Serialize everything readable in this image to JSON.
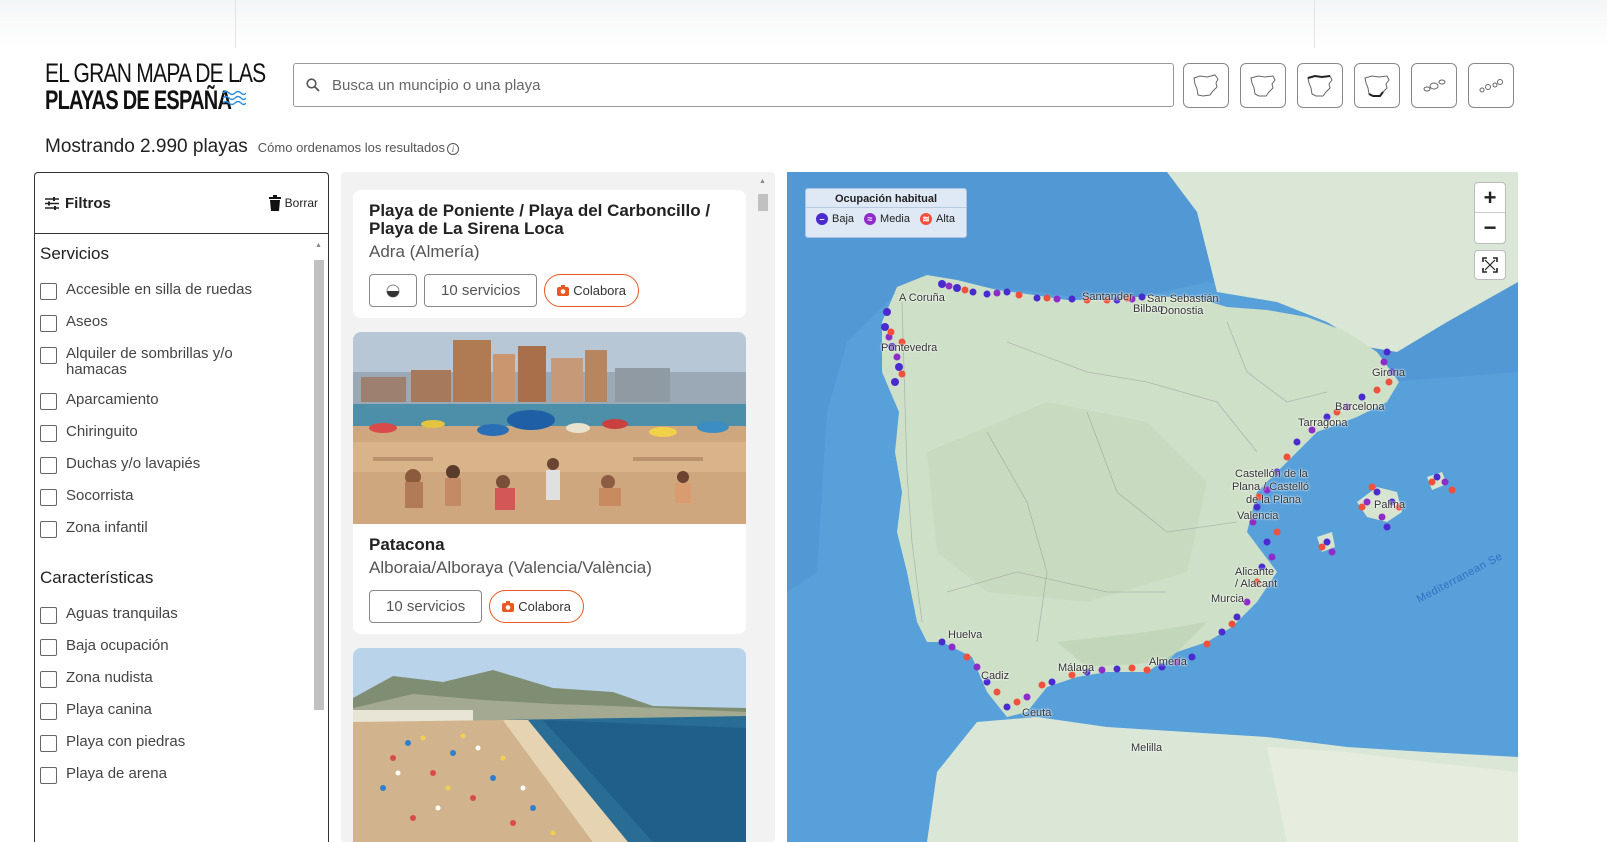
{
  "header": {
    "logo_line1": "EL GRAN MAPA DE LAS",
    "logo_line2": "PLAYAS DE ESPAÑA",
    "search_placeholder": "Busca un muncipio o una playa",
    "region_buttons": [
      "peninsula-map-icon",
      "peninsula-outline-icon",
      "peninsula-north-icon",
      "peninsula-south-icon",
      "balearic-islands-icon",
      "canary-islands-icon"
    ]
  },
  "summary": {
    "count_text": "Mostrando 2.990 playas",
    "how_text": "Cómo ordenamos los resultados",
    "info_glyph": "i"
  },
  "filters": {
    "title": "Filtros",
    "clear_label": "Borrar",
    "sections": [
      {
        "title": "Servicios",
        "items": [
          "Accesible en silla de ruedas",
          "Aseos",
          "Alquiler de sombrillas y/o hamacas",
          "Aparcamiento",
          "Chiringuito",
          "Duchas y/o lavapiés",
          "Socorrista",
          "Zona infantil"
        ]
      },
      {
        "title": "Características",
        "items": [
          "Aguas tranquilas",
          "Baja ocupación",
          "Zona nudista",
          "Playa canina",
          "Playa con piedras",
          "Playa de arena"
        ]
      }
    ]
  },
  "results": [
    {
      "title": "Playa de Poniente / Playa del Carboncillo / Playa de La Sirena Loca",
      "location": "Adra (Almería)",
      "services": "10 servicios",
      "collaborate": "Colabora"
    },
    {
      "title": "Patacona",
      "location": "Alboraia/Alboraya (Valencia/València)",
      "services": "10 servicios",
      "collaborate": "Colabora"
    }
  ],
  "map": {
    "legend_title": "Ocupación habitual",
    "legend": [
      {
        "label": "Baja",
        "color": "#4a2bd0",
        "glyph": "–"
      },
      {
        "label": "Media",
        "color": "#8e2cc9",
        "glyph": "≈"
      },
      {
        "label": "Alta",
        "color": "#f0503c",
        "glyph": "≋"
      }
    ],
    "zoom_in": "+",
    "zoom_out": "−",
    "cities": [
      {
        "name": "A Coruña"
      },
      {
        "name": "Santander"
      },
      {
        "name": "San Sebastián"
      },
      {
        "name": "Bilbao"
      },
      {
        "name": "Donostia"
      },
      {
        "name": "Pontevedra"
      },
      {
        "name": "Girona"
      },
      {
        "name": "Barcelona"
      },
      {
        "name": "Tarragona"
      },
      {
        "name": "Castellón de la"
      },
      {
        "name": "Plana / Castelló"
      },
      {
        "name": "de la Plana"
      },
      {
        "name": "Valencia"
      },
      {
        "name": "Palma"
      },
      {
        "name": "Alicante"
      },
      {
        "name": "/ Alacant"
      },
      {
        "name": "Murcia"
      },
      {
        "name": "Huelva"
      },
      {
        "name": "Málaga"
      },
      {
        "name": "Almería"
      },
      {
        "name": "Cadiz"
      },
      {
        "name": "Ceuta"
      },
      {
        "name": "Melilla"
      }
    ],
    "sea_label": "Mediterranean Se"
  }
}
